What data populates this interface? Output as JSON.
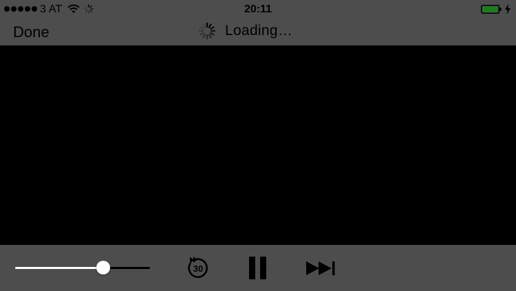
{
  "status_bar": {
    "carrier": "3 AT",
    "time": "20:11",
    "signal_bars": 5,
    "battery_level": 1.0,
    "icons": [
      "wifi-icon",
      "activity-spinner-icon",
      "battery-icon",
      "charging-bolt-icon"
    ]
  },
  "nav": {
    "done_label": "Done",
    "loading_label": "Loading…"
  },
  "controls": {
    "volume_level": 0.67,
    "skip_back_seconds": "30",
    "icons": [
      "skip-back-30-icon",
      "pause-icon",
      "next-track-icon"
    ]
  },
  "colors": {
    "bar_background": "#4d4d4d",
    "video_background": "#000000",
    "battery_fill": "#1c7f1c",
    "slider_fill": "#ffffff"
  }
}
